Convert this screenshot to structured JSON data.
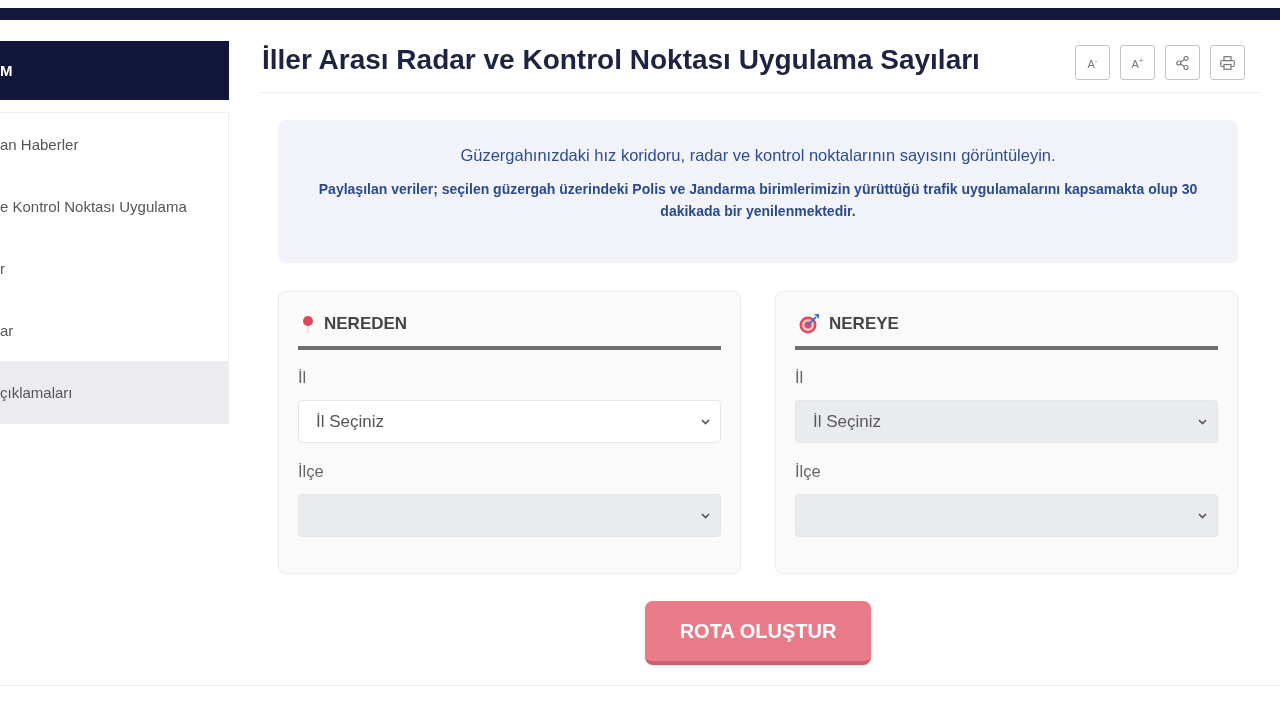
{
  "sidebar": {
    "header": "M",
    "items": [
      {
        "label": "an Haberler",
        "selected": false
      },
      {
        "label": "e Kontrol Noktası Uygulama",
        "selected": false
      },
      {
        "label": "r",
        "selected": false
      },
      {
        "label": "ar",
        "selected": false
      },
      {
        "label": "çıklamaları",
        "selected": true
      }
    ]
  },
  "page": {
    "title": "İller Arası Radar ve Kontrol Noktası Uygulama Sayıları",
    "tools": [
      {
        "kind": "smaller",
        "label": "A$^{-}$"
      },
      {
        "kind": "larger",
        "label": "A$^{+}$"
      },
      {
        "kind": "share"
      },
      {
        "kind": "print"
      }
    ]
  },
  "info": {
    "lead": "Güzergahınızdaki hız koridoru, radar ve kontrol noktalarının sayısını görüntüleyin.",
    "note": "Paylaşılan veriler; seçilen güzergah üzerindeki Polis ve Jandarma birimlerimizin yürüttüğü trafik uygulamalarını kapsamakta olup 30 dakikada bir yenilenmektedir."
  },
  "route": [
    {
      "kind": "origin",
      "title": "NEREDEN",
      "fields": [
        {
          "label": "İl",
          "value": "İl Seçiniz",
          "disabled": false
        },
        {
          "label": "İlçe",
          "disabled": true
        }
      ]
    },
    {
      "kind": "destination",
      "title": "NEREYE",
      "fields": [
        {
          "label": "İl",
          "value": "İl Seçiniz",
          "disabled": true
        },
        {
          "label": "İlçe",
          "disabled": true
        }
      ]
    }
  ],
  "submit": {
    "label": "ROTA OLUŞTUR",
    "disabled": true
  }
}
